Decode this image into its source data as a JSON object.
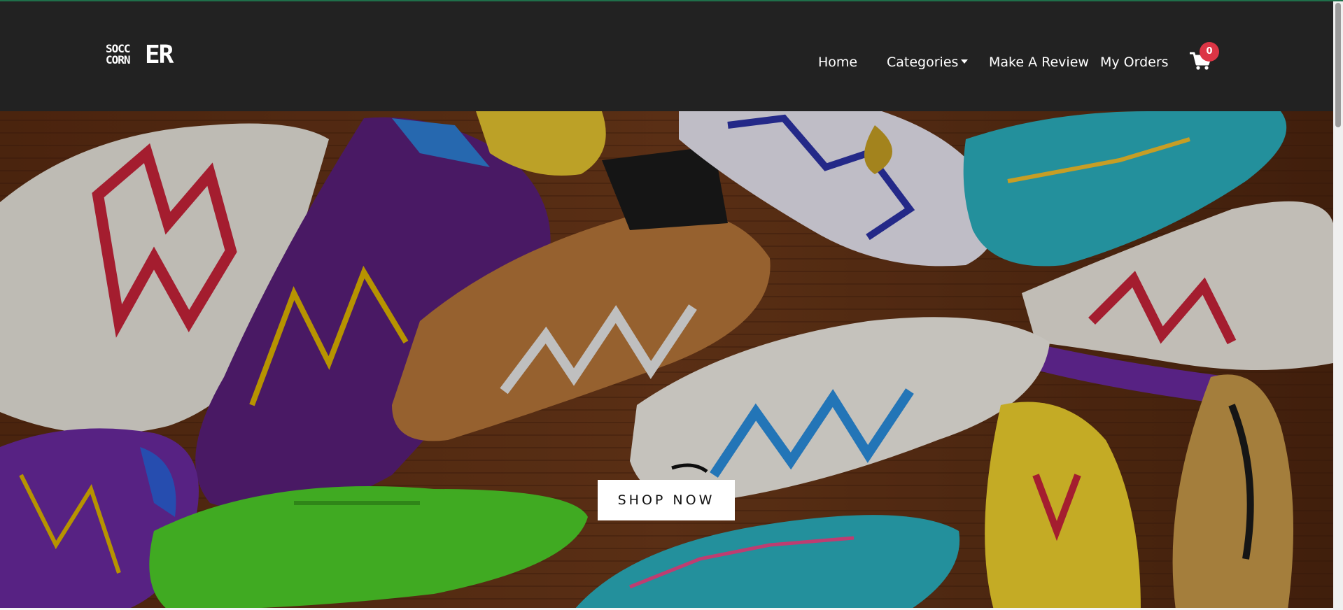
{
  "brand": {
    "logo_line1": "SOCC",
    "logo_line2": "CORN",
    "logo_big": "ER"
  },
  "nav": {
    "home": "Home",
    "categories": "Categories",
    "review": "Make A Review",
    "orders": "My Orders"
  },
  "cart": {
    "count": "0",
    "icon": "shopping-cart-icon"
  },
  "hero": {
    "cta_label": "SHOP NOW",
    "image": "soccer-boots-collage"
  },
  "colors": {
    "navbar_bg": "#222222",
    "badge_bg": "#dc3545",
    "cta_bg": "#ffffff",
    "hero_wood": "#6b3a1c"
  }
}
